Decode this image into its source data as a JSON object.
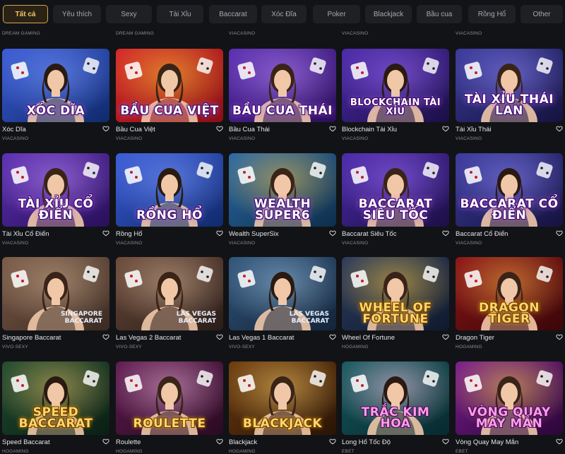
{
  "tabs": [
    {
      "label": "Tất cả",
      "active": true
    },
    {
      "label": "Yêu thích",
      "active": false
    },
    {
      "label": "Sexy",
      "active": false
    },
    {
      "label": "Tài Xỉu",
      "active": false
    },
    {
      "label": "Baccarat",
      "active": false
    },
    {
      "label": "Xóc Đĩa",
      "active": false
    },
    {
      "label": "Poker",
      "active": false
    },
    {
      "label": "Blackjack",
      "active": false
    },
    {
      "label": "Bầu cua",
      "active": false
    },
    {
      "label": "Rồng Hổ",
      "active": false
    },
    {
      "label": "Other",
      "active": false
    }
  ],
  "top_providers": [
    "DREAM GAMING",
    "DREAM GAMING",
    "VIACASINO",
    "VIACASINO",
    "VIACASINO"
  ],
  "games": [
    {
      "name": "Xóc Dĩa",
      "provider": "VIACASINO",
      "thumb_title": "Xóc Dĩa",
      "theme": "blue",
      "title_style": ""
    },
    {
      "name": "Bầu Cua Việt",
      "provider": "VIACASINO",
      "thumb_title": "Bầu Cua Việt",
      "theme": "red",
      "title_style": ""
    },
    {
      "name": "Bầu Cua Thái",
      "provider": "VIACASINO",
      "thumb_title": "Bầu Cua Thái",
      "theme": "purple",
      "title_style": ""
    },
    {
      "name": "Blockchain Tài Xỉu",
      "provider": "VIACASINO",
      "thumb_title": "Blockchain Tài Xỉu",
      "theme": "violet",
      "title_style": "small"
    },
    {
      "name": "Tài Xỉu Thái",
      "provider": "VIACASINO",
      "thumb_title": "Tài Xỉu Thái Lan",
      "theme": "indigo",
      "title_style": ""
    },
    {
      "name": "Tài Xỉu Cổ Điển",
      "provider": "VIACASINO",
      "thumb_title": "Tài Xỉu Cổ Điển",
      "theme": "purple",
      "title_style": ""
    },
    {
      "name": "Rồng Hổ",
      "provider": "VIACASINO",
      "thumb_title": "Rồng Hổ",
      "theme": "blue",
      "title_style": ""
    },
    {
      "name": "Wealth SuperSix",
      "provider": "VIACASINO",
      "thumb_title": "Wealth Super6",
      "theme": "teal",
      "title_style": ""
    },
    {
      "name": "Baccarat Siêu Tốc",
      "provider": "VIACASINO",
      "thumb_title": "Baccarat Siêu Tốc",
      "theme": "violet",
      "title_style": ""
    },
    {
      "name": "Baccarat Cổ Điển",
      "provider": "VIACASINO",
      "thumb_title": "Baccarat Cổ Điển",
      "theme": "indigo",
      "title_style": ""
    },
    {
      "name": "Singapore Baccarat",
      "provider": "VIVO-SEXY",
      "thumb_title": "Singapore Baccarat",
      "theme": "room",
      "title_style": "tiny"
    },
    {
      "name": "Las Vegas 2 Baccarat",
      "provider": "VIVO-SEXY",
      "thumb_title": "Las Vegas Baccarat",
      "theme": "room2",
      "title_style": "tiny"
    },
    {
      "name": "Las Vegas 1 Baccarat",
      "provider": "VIVO-SEXY",
      "thumb_title": "Las Vegas Baccarat",
      "theme": "room3",
      "title_style": "tiny"
    },
    {
      "name": "Wheel Of Fortune",
      "provider": "HOGAMING",
      "thumb_title": "Wheel of Fortune",
      "theme": "night",
      "title_style": "gold"
    },
    {
      "name": "Dragon Tiger",
      "provider": "HOGAMING",
      "thumb_title": "Dragon Tiger",
      "theme": "crimson",
      "title_style": "gold"
    },
    {
      "name": "Speed Baccarat",
      "provider": "HOGAMING",
      "thumb_title": "Speed Baccarat",
      "theme": "forest",
      "title_style": "gold"
    },
    {
      "name": "Roulette",
      "provider": "HOGAMING",
      "thumb_title": "Roulette",
      "theme": "plum",
      "title_style": "gold"
    },
    {
      "name": "Blackjack",
      "provider": "HOGAMING",
      "thumb_title": "Blackjack",
      "theme": "amber",
      "title_style": "gold"
    },
    {
      "name": "Long Hổ Tốc Độ",
      "provider": "EBET",
      "thumb_title": "Trắc Kim Hoa",
      "theme": "deepteal",
      "title_style": "pink"
    },
    {
      "name": "Vòng Quay May Mắn",
      "provider": "EBET",
      "thumb_title": "Vòng Quay May Mắn",
      "theme": "magenta",
      "title_style": "pink"
    }
  ],
  "colors": {
    "background": "#121316",
    "tab_bg": "#1e2024",
    "accent_gold": "#d2a74c"
  },
  "icons": {
    "favorite": "heart-outline-icon"
  }
}
